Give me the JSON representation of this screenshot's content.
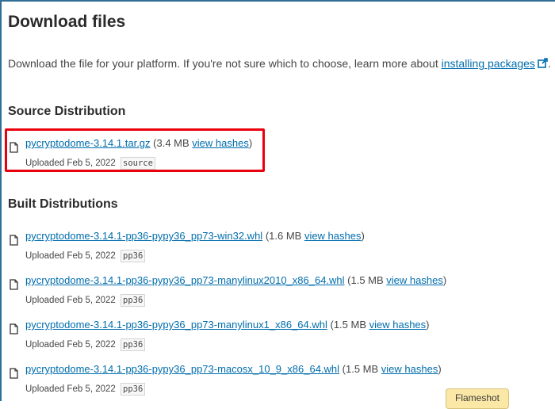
{
  "page": {
    "title": "Download files",
    "intro_text": "Download the file for your platform. If you're not sure which to choose, learn more about ",
    "intro_link": "installing packages",
    "intro_end": "."
  },
  "source_distribution": {
    "heading": "Source Distribution",
    "files": [
      {
        "name": "pycryptodome-3.14.1.tar.gz",
        "size": "(3.4 MB ",
        "hashes": "view hashes",
        "close": ")",
        "uploaded": "Uploaded Feb 5, 2022",
        "tag": "source"
      }
    ]
  },
  "built_distributions": {
    "heading": "Built Distributions",
    "files": [
      {
        "name": "pycryptodome-3.14.1-pp36-pypy36_pp73-win32.whl",
        "size": "(1.6 MB ",
        "hashes": "view hashes",
        "close": ")",
        "uploaded": "Uploaded Feb 5, 2022",
        "tag": "pp36"
      },
      {
        "name": "pycryptodome-3.14.1-pp36-pypy36_pp73-manylinux2010_x86_64.whl",
        "size": "(1.5 MB ",
        "hashes": "view hashes",
        "close": ")",
        "uploaded": "Uploaded Feb 5, 2022",
        "tag": "pp36"
      },
      {
        "name": "pycryptodome-3.14.1-pp36-pypy36_pp73-manylinux1_x86_64.whl",
        "size": "(1.5 MB ",
        "hashes": "view hashes",
        "close": ")",
        "uploaded": "Uploaded Feb 5, 2022",
        "tag": "pp36"
      },
      {
        "name": "pycryptodome-3.14.1-pp36-pypy36_pp73-macosx_10_9_x86_64.whl",
        "size": "(1.5 MB ",
        "hashes": "view hashes",
        "close": ")",
        "uploaded": "Uploaded Feb 5, 2022",
        "tag": "pp36"
      }
    ]
  },
  "overlay": {
    "flameshot_label": "Flameshot"
  },
  "icons": {
    "file": "file-icon",
    "external": "external-link-icon"
  },
  "colors": {
    "link": "#006dad",
    "highlight": "#e8000d"
  }
}
